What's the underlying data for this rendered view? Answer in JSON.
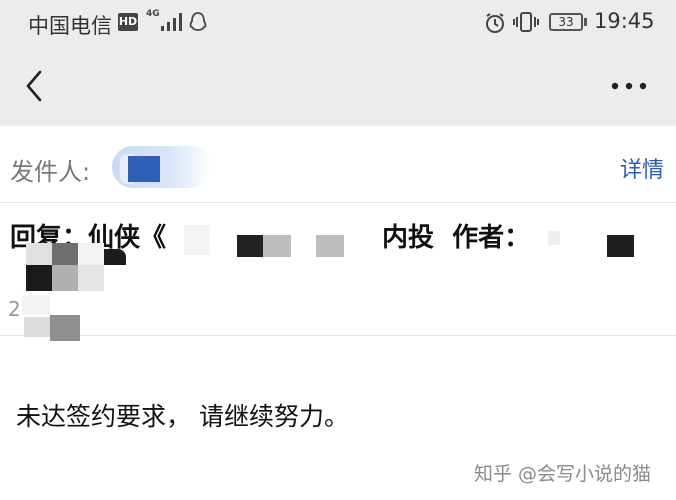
{
  "status_bar": {
    "carrier": "中国电信",
    "hd_badge": "HD",
    "network_type": "4G",
    "battery": "33",
    "time": "19:45",
    "icons": [
      "signal-icon",
      "qq-icon",
      "alarm-icon",
      "vibrate-icon",
      "battery-icon"
    ]
  },
  "nav": {
    "back_icon": "chevron-left-icon",
    "more_icon": "more-dots-icon"
  },
  "mail": {
    "sender_label": "发件人:",
    "details_label": "详情",
    "subject_start": "回复：仙侠《",
    "subject_mid": "内投  作者：",
    "date_partial": "2",
    "body": "未达签约要求， 请继续努力。"
  },
  "watermark": "知乎 @会写小说的猫",
  "colors": {
    "header_bg": "#ececec",
    "link": "#2a5db0",
    "avatar": "#2f5fb8"
  }
}
